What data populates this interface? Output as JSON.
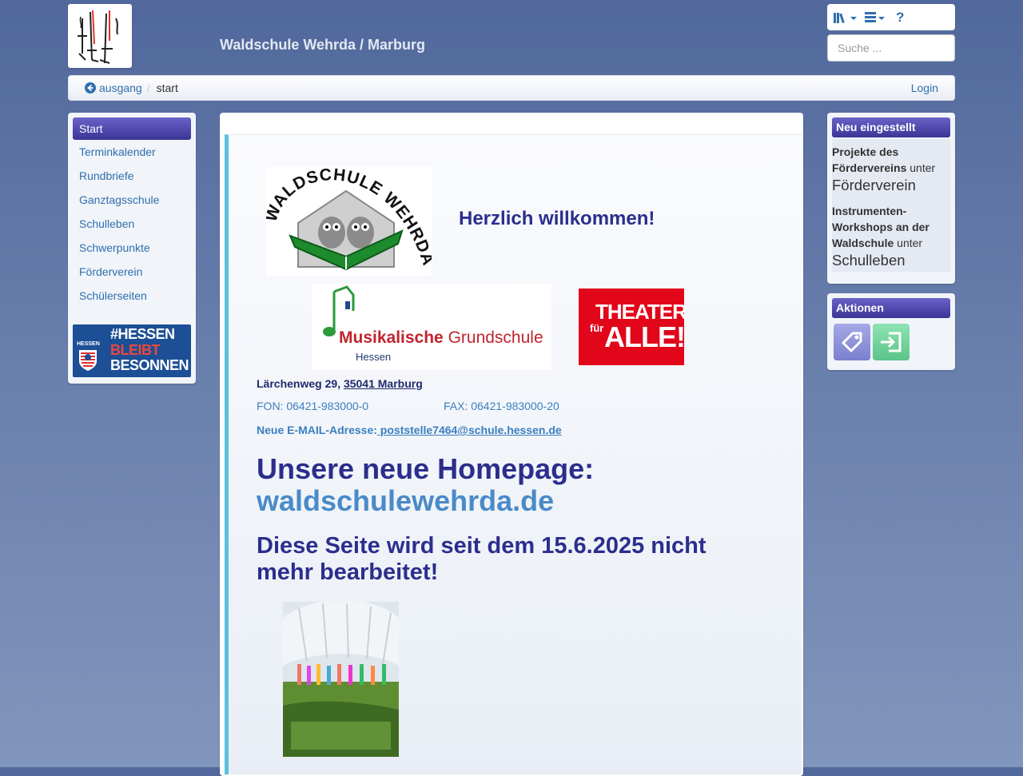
{
  "header": {
    "site_title": "Waldschule Wehrda / Marburg",
    "search_placeholder": "Suche ...",
    "tools": [
      {
        "name": "sitetools",
        "icon": "library-books-icon"
      },
      {
        "name": "usertools",
        "icon": "list-menu-icon"
      },
      {
        "name": "help",
        "icon": "help-icon",
        "label": "?"
      }
    ]
  },
  "breadcrumb": {
    "back_label": "ausgang",
    "back_icon": "circle-arrow-left-icon",
    "separator": "/",
    "current": "start",
    "login": "Login"
  },
  "sidebar": {
    "items": [
      {
        "label": "Start",
        "active": true
      },
      {
        "label": "Terminkalender"
      },
      {
        "label": "Rundbriefe"
      },
      {
        "label": "Ganztagsschule"
      },
      {
        "label": "Schulleben"
      },
      {
        "label": "Schwerpunkte"
      },
      {
        "label": "Förderverein"
      },
      {
        "label": "Schülerseiten"
      }
    ],
    "banner": {
      "small": "HESSEN",
      "line1": "#HESSEN",
      "line2": "BLEIBT",
      "line3": "BESONNEN"
    }
  },
  "main": {
    "school_logo_text": "WALDSCHULE WEHRDA",
    "welcome": "Herzlich willkommen!",
    "music_logo": {
      "title_bold": "Musikalische",
      "title_rest": " Grundschule",
      "sub": "Hessen"
    },
    "theater_logo": {
      "line1": "THEATER",
      "line2": "für",
      "line3": "ALLE!"
    },
    "address_street": "Lärchenweg 29,",
    "address_city": "35041 Marburg",
    "fon": "FON: 06421-983000-0",
    "fax": "FAX: 06421-983000-20",
    "email_label": "Neue E-MAIL-Adresse:",
    "email": " poststelle7464@schule.hessen.de",
    "homepage_heading": "Unsere neue Homepage:",
    "homepage_url": "waldschulewehrda.de",
    "notice": "Diese Seite wird seit dem 15.6.2025 nicht mehr bearbeitet!"
  },
  "right": {
    "recent_title": "Neu eingestellt",
    "recent": [
      {
        "title": "Projekte des Fördervereins",
        "under": "unter",
        "section": "Förderverein"
      },
      {
        "title": "Instrumenten-Workshops an der Waldschule",
        "under": "unter",
        "section": "Schulleben"
      }
    ],
    "actions_title": "Aktionen",
    "actions": [
      {
        "icon": "tag-icon",
        "color": "#8a8fd8"
      },
      {
        "icon": "login-icon",
        "color": "#6fcf97"
      }
    ]
  }
}
